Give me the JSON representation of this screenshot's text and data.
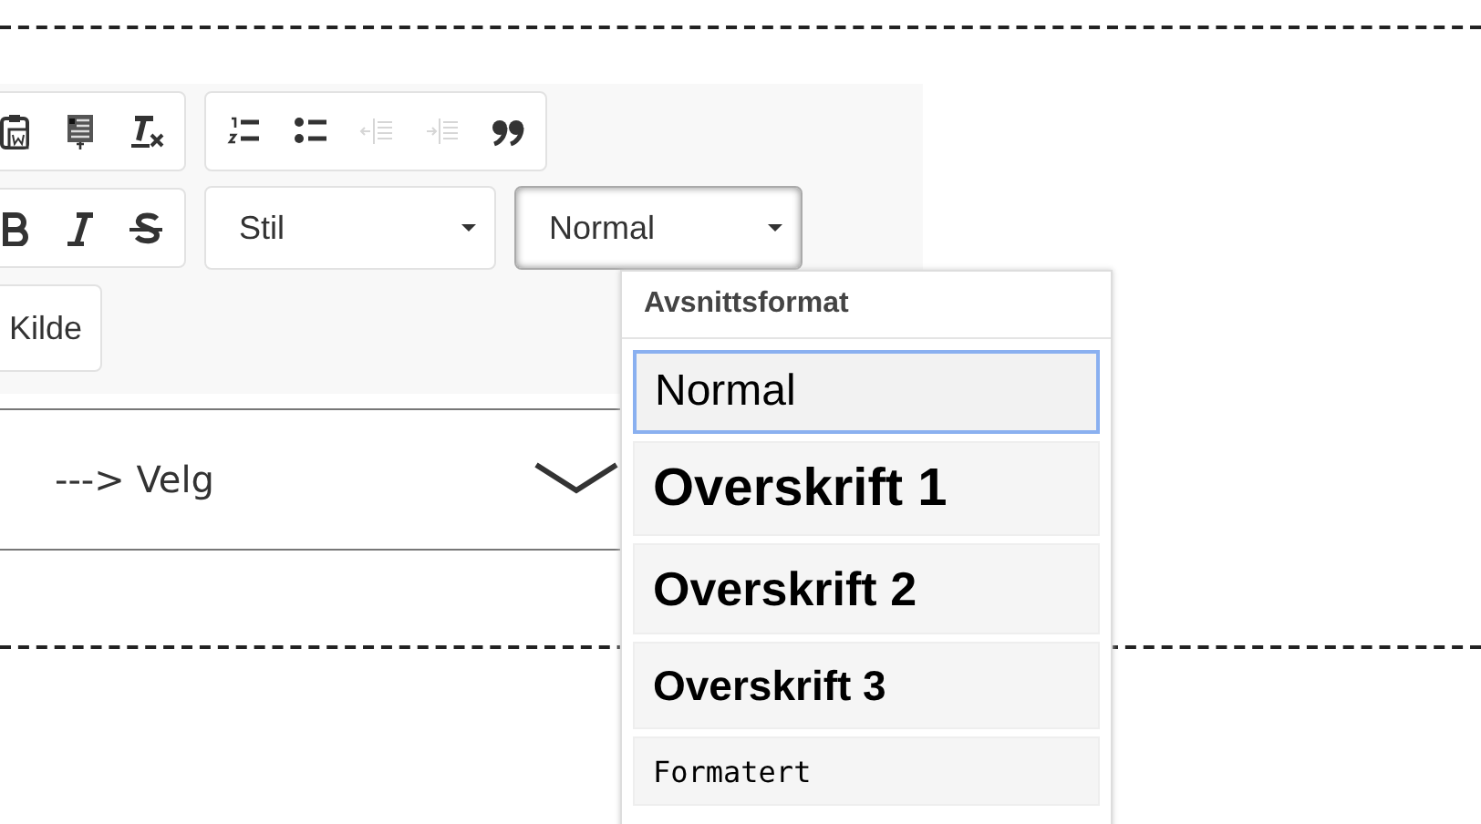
{
  "toolbar": {
    "rows": [
      {
        "groups": [
          {
            "buttons": [
              {
                "kind": "paste-word",
                "disabled": false
              },
              {
                "kind": "paste-text",
                "disabled": false
              },
              {
                "kind": "remove-format",
                "disabled": false
              }
            ]
          },
          {
            "buttons": [
              {
                "kind": "numbered-list",
                "disabled": false
              },
              {
                "kind": "bulleted-list",
                "disabled": false
              },
              {
                "kind": "outdent",
                "disabled": true
              },
              {
                "kind": "indent",
                "disabled": true
              },
              {
                "kind": "blockquote",
                "disabled": false
              }
            ]
          }
        ]
      },
      {
        "groups": [
          {
            "buttons": [
              {
                "kind": "bold",
                "disabled": false
              },
              {
                "kind": "italic",
                "disabled": false
              },
              {
                "kind": "strike",
                "disabled": false
              }
            ]
          }
        ],
        "combos": [
          {
            "label": "Stil",
            "open": false
          },
          {
            "label": "Normal",
            "open": true
          }
        ]
      },
      {
        "source_button": "Kilde"
      }
    ]
  },
  "select": {
    "value": "---> Velg"
  },
  "dropdown": {
    "header": "Avsnittsformat",
    "items": [
      {
        "label": "Normal",
        "kind": "normal",
        "selected": true
      },
      {
        "label": "Overskrift 1",
        "kind": "h1",
        "selected": false
      },
      {
        "label": "Overskrift 2",
        "kind": "h2",
        "selected": false
      },
      {
        "label": "Overskrift 3",
        "kind": "h3",
        "selected": false
      },
      {
        "label": "Formatert",
        "kind": "pre",
        "selected": false
      }
    ]
  }
}
